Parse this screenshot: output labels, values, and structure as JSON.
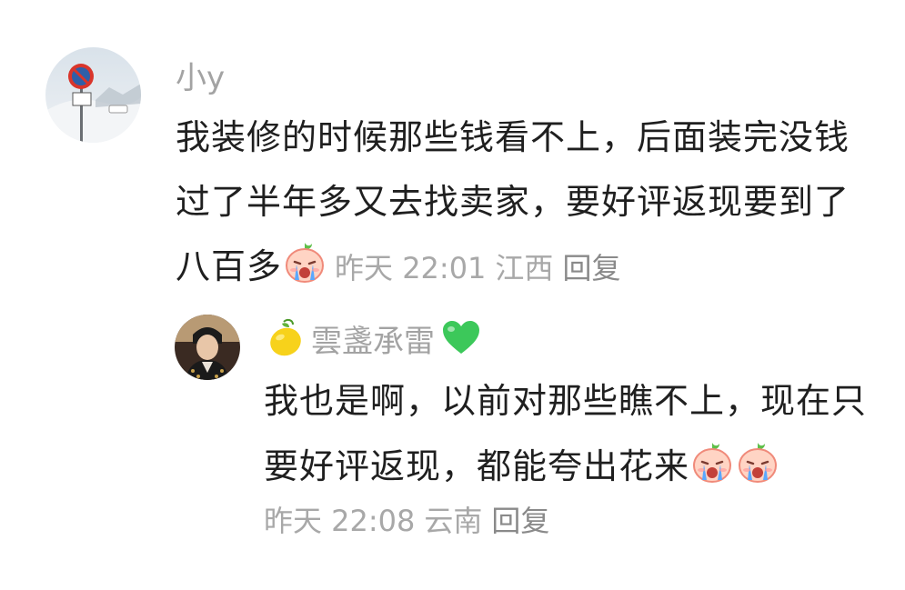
{
  "comments": [
    {
      "username": "小y",
      "avatar": "snowy-road-sign-avatar",
      "text": "我装修的时候那些钱看不上，后面装完没钱过了半年多又去找卖家，要好评返现要到了八百多",
      "emoji_count": 1,
      "emoji": "crying-face-emoji",
      "time": "昨天 22:01",
      "location": "江西",
      "reply_label": "回复"
    }
  ],
  "replies": [
    {
      "username": "雲盞承雷",
      "name_prefix_icon": "lemon-icon",
      "name_suffix_icon": "green-heart-icon",
      "avatar": "person-avatar",
      "text": "我也是啊，以前对那些瞧不上，现在只要好评返现，都能夸出花来",
      "emoji_count": 2,
      "emoji": "crying-face-emoji",
      "time": "昨天 22:08",
      "location": "云南",
      "reply_label": "回复"
    }
  ],
  "colors": {
    "username": "#a3a3a3",
    "text": "#1f1f1f",
    "meta": "#a8a8a8"
  }
}
